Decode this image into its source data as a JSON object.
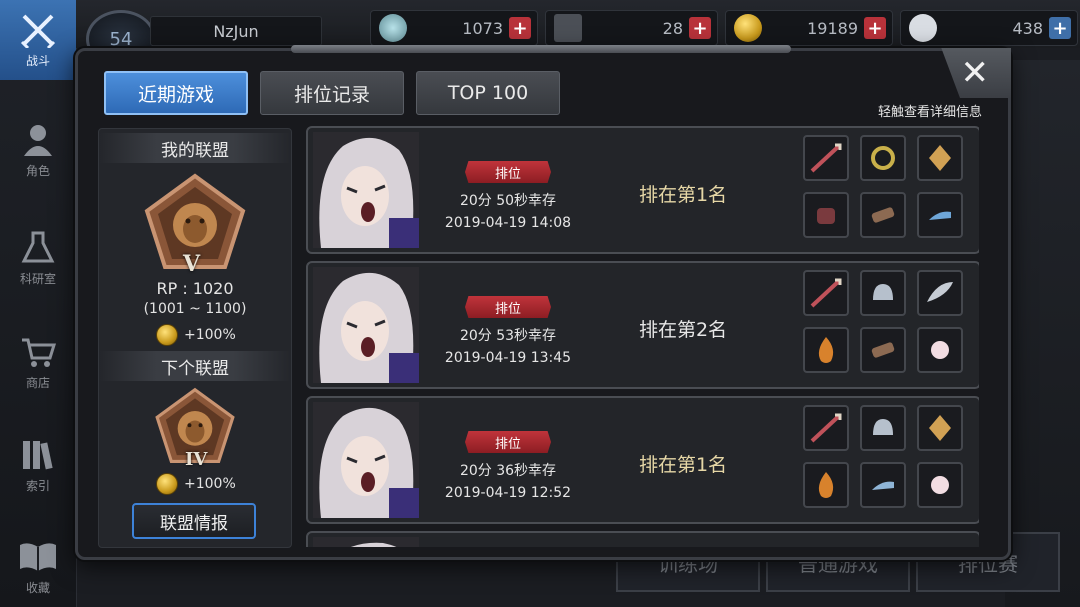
{
  "background": {
    "left_nav": [
      {
        "label": "战斗",
        "icon": "crossed-swords-icon",
        "active": true
      },
      {
        "label": "角色",
        "icon": "character-icon",
        "active": false
      },
      {
        "label": "科研室",
        "icon": "flask-icon",
        "active": false
      },
      {
        "label": "商店",
        "icon": "shopping-cart-icon",
        "active": false
      },
      {
        "label": "索引",
        "icon": "books-icon",
        "active": false
      },
      {
        "label": "收藏",
        "icon": "open-book-icon",
        "active": false
      }
    ],
    "player": {
      "level": "54",
      "name": "NzJun"
    },
    "currencies": [
      {
        "icon": "feather-icon",
        "value": "1073"
      },
      {
        "icon": "blade-icon",
        "value": "28"
      },
      {
        "icon": "gold-coin-icon",
        "value": "19189"
      },
      {
        "icon": "bp-paw-icon",
        "value": "438"
      }
    ],
    "bottom_buttons": [
      "训练场",
      "普通游戏",
      "排位赛"
    ]
  },
  "modal": {
    "tabs": [
      {
        "label": "近期游戏",
        "active": true
      },
      {
        "label": "排位记录",
        "active": false
      },
      {
        "label": "TOP 100",
        "active": false
      }
    ],
    "hint": "轻触查看详细信息",
    "close": "✕",
    "alliance": {
      "my_title": "我的联盟",
      "my_rank": "V",
      "rp": "RP : 1020",
      "rp_range": "(1001 ~ 1100)",
      "my_bonus": "+100%",
      "next_title": "下个联盟",
      "next_rank": "IV",
      "next_bonus": "+100%",
      "info_button": "联盟情报"
    },
    "matches": [
      {
        "mode": "排位",
        "survival": "20分 50秒幸存",
        "time": "2019-04-19 14:08",
        "placement": "排在第1名",
        "items": [
          "spear-icon",
          "ring-icon",
          "gem-icon",
          "gauntlet-icon",
          "armguard-icon",
          "shoes-icon"
        ]
      },
      {
        "mode": "排位",
        "survival": "20分 53秒幸存",
        "time": "2019-04-19 13:45",
        "placement": "排在第2名",
        "items": [
          "spear-icon",
          "helmet-icon",
          "wing-icon",
          "flame-icon",
          "armguard-icon",
          "pearl-icon"
        ]
      },
      {
        "mode": "排位",
        "survival": "20分 36秒幸存",
        "time": "2019-04-19 12:52",
        "placement": "排在第1名",
        "items": [
          "spear-icon",
          "helmet-icon",
          "gem-icon",
          "flame-icon",
          "shoes-icon",
          "pearl-icon"
        ]
      }
    ],
    "colors": {
      "tab_active": "#3d7ccc",
      "mode_tag": "#b02a31",
      "placement_text": "#e6d7a6",
      "info_border": "#3d82d8"
    }
  }
}
